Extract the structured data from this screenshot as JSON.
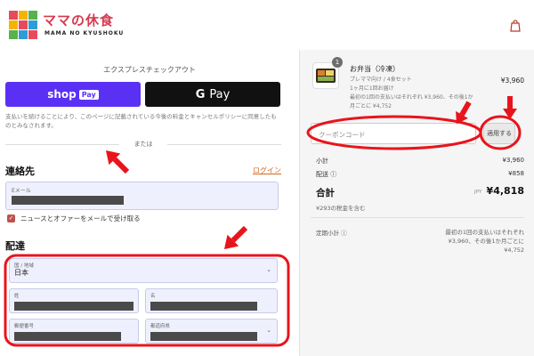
{
  "brand": {
    "logo_text": "ママの休食",
    "logo_sub": "MAMA NO KYUSHOKU",
    "accent": "#d63a4f"
  },
  "header": {
    "cart_icon": "shopping-bag-icon"
  },
  "express": {
    "title": "エクスプレスチェックアウト",
    "shop_pay_label": "shop",
    "shop_pay_badge": "Pay",
    "shop_pay_color": "#5a31f4",
    "gpay_g": "G",
    "gpay_label": "Pay",
    "notice": "支払いを続けることにより、このページに記載されている今後の料金とキャンセルポリシーに同意したものとみなされます。",
    "divider_text": "または"
  },
  "contact": {
    "title": "連絡先",
    "login_link": "ログイン",
    "email_label": "Eメール",
    "newsletter_checked": true,
    "newsletter_label": "ニュースとオファーをメールで受け取る"
  },
  "delivery": {
    "title": "配達",
    "country_label": "国 / 地域",
    "country_value": "日本",
    "last_name_label": "姓",
    "first_name_label": "名",
    "postal_label": "郵便番号",
    "prefecture_label": "都道府県"
  },
  "order": {
    "item": {
      "quantity": "1",
      "name": "お弁当（冷凍）",
      "sub1": "プレママ向け / 4食セット",
      "sub2": "1ヶ月に1回お届け",
      "sub3": "最初の1回の支払いはそれぞれ ¥3,960、その後1か",
      "sub4": "月ごとに ¥4,752",
      "price": "¥3,960"
    },
    "coupon_placeholder": "クーポンコード",
    "apply_label": "適用する",
    "subtotal_label": "小計",
    "subtotal_value": "¥3,960",
    "shipping_label": "配送 ⓘ",
    "shipping_value": "¥858",
    "total_label": "合計",
    "total_currency": "JPY",
    "total_value": "¥4,818",
    "tax_note": "¥293の税金を含む",
    "recurring_label": "定期小計 ⓘ",
    "recurring_text1": "最初の1回の支払いはそれぞれ",
    "recurring_text2": "¥3,960、その後1か月ごとに",
    "recurring_text3": "¥4,752"
  },
  "annotation_color": "#e8141c"
}
